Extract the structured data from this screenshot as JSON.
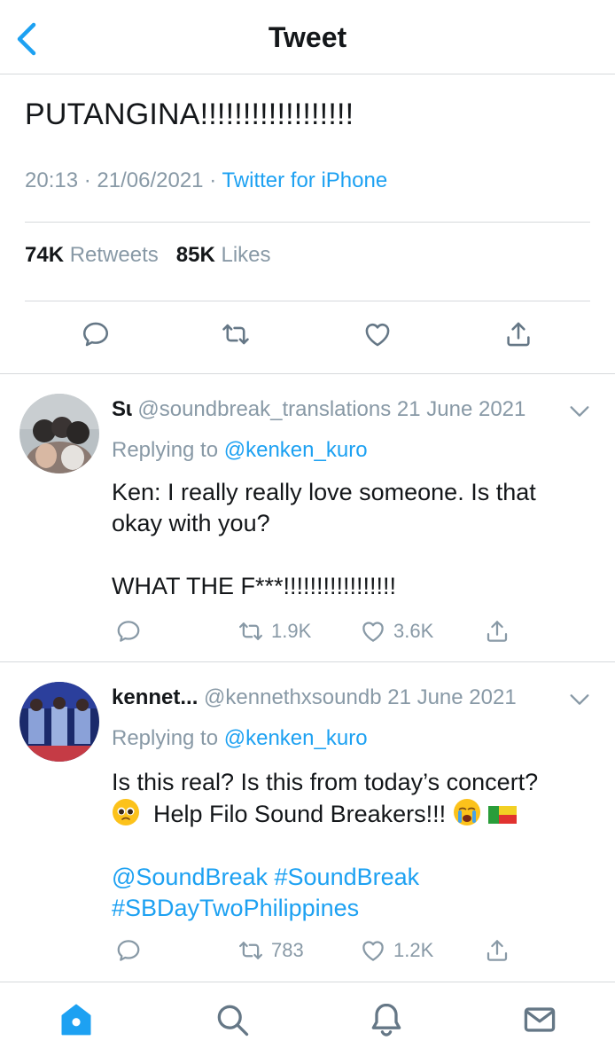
{
  "header": {
    "title": "Tweet"
  },
  "tweet": {
    "text": "PUTANGINA!!!!!!!!!!!!!!!!!!",
    "time": "20:13",
    "date": "21/06/2021",
    "source": "Twitter for iPhone",
    "retweets_count": "74K",
    "retweets_label": "Retweets",
    "likes_count": "85K",
    "likes_label": "Likes"
  },
  "replies": [
    {
      "name": "S",
      "handle": "@soundbreak_translations",
      "date": "21 June 2021",
      "replying_label": "Replying to",
      "replying_handle": "@kenken_kuro",
      "body_line1": "Ken: I really really love someone. Is that",
      "body_line2": "okay with you?",
      "body_line3": "WHAT THE F***!!!!!!!!!!!!!!!!!",
      "retweets": "1.9K",
      "likes": "3.6K"
    },
    {
      "name": "kennet...",
      "handle": "@kennethxsoundb",
      "date": "21 June 2021",
      "replying_label": "Replying to",
      "replying_handle": "@kenken_kuro",
      "body_line1": "Is this real? Is this from today’s concert?",
      "body_line2": "Help Filo Sound Breakers!!!",
      "tag_line1": "@SoundBreak #SoundBreak",
      "tag_line2": "#SBDayTwoPhilippines",
      "retweets": "783",
      "likes": "1.2K"
    }
  ],
  "colors": {
    "accent": "#1da1f2",
    "muted": "#8899a6",
    "text": "#14171a",
    "divider": "#d6d9dc"
  },
  "icons": [
    "back-icon",
    "reply-icon",
    "retweet-icon",
    "like-icon",
    "share-icon",
    "chevron-down-icon",
    "home-icon",
    "search-icon",
    "notifications-icon",
    "messages-icon"
  ]
}
